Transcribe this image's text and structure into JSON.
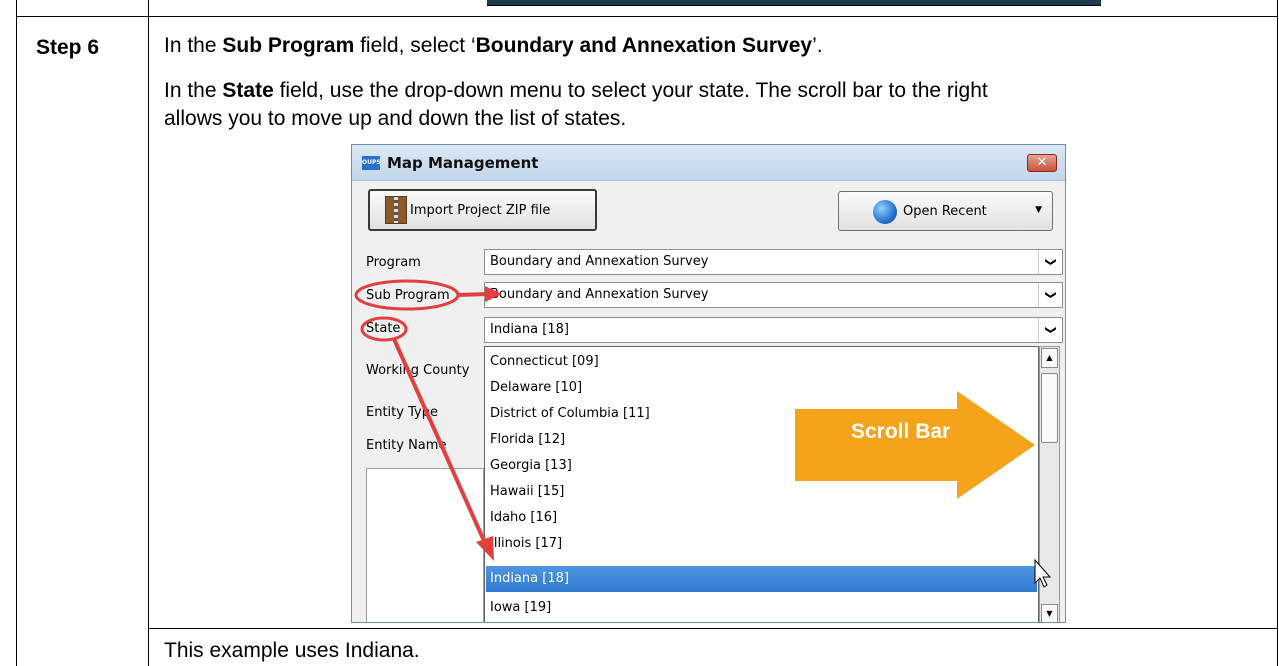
{
  "step": {
    "label": "Step 6"
  },
  "instructions": {
    "line1": {
      "pre": "In the ",
      "b1": "Sub Program",
      "mid": " field, select ‘",
      "b2": "Boundary and Annexation Survey",
      "post": "’."
    },
    "line2": {
      "pre": "In the ",
      "b1": "State",
      "post": " field, use the drop-down menu to select your state. The scroll bar to the right"
    },
    "line3": "allows you to move up and down the list of states.",
    "footer": "This example uses Indiana."
  },
  "window": {
    "title": "Map Management",
    "app_icon_text": "OUPS",
    "close_glyph": "✕",
    "import_button": "Import Project ZIP file",
    "recent_button": "Open Recent",
    "recent_caret": "▼",
    "fields": {
      "program_label": "Program",
      "program_value": "Boundary and Annexation Survey",
      "subprogram_label": "Sub Program",
      "subprogram_value": "Boundary and Annexation Survey",
      "state_label": "State",
      "state_value": "Indiana [18]",
      "working_county_label": "Working County",
      "entity_type_label": "Entity Type",
      "entity_name_label": "Entity Name"
    },
    "combo_arrow": "❯",
    "states": [
      "Connecticut [09]",
      "Delaware [10]",
      "District of Columbia [11]",
      "Florida [12]",
      "Georgia [13]",
      "Hawaii [15]",
      "Idaho [16]",
      "Illinois [17]",
      "Indiana [18]",
      "Iowa [19]"
    ],
    "selected_state": "Indiana [18]",
    "callout": "Scroll Bar",
    "scroll_up": "▲",
    "scroll_down": "▼"
  },
  "colors": {
    "highlight": "#2f7bd2",
    "callout": "#f5a31a",
    "annotation": "#e04040"
  }
}
